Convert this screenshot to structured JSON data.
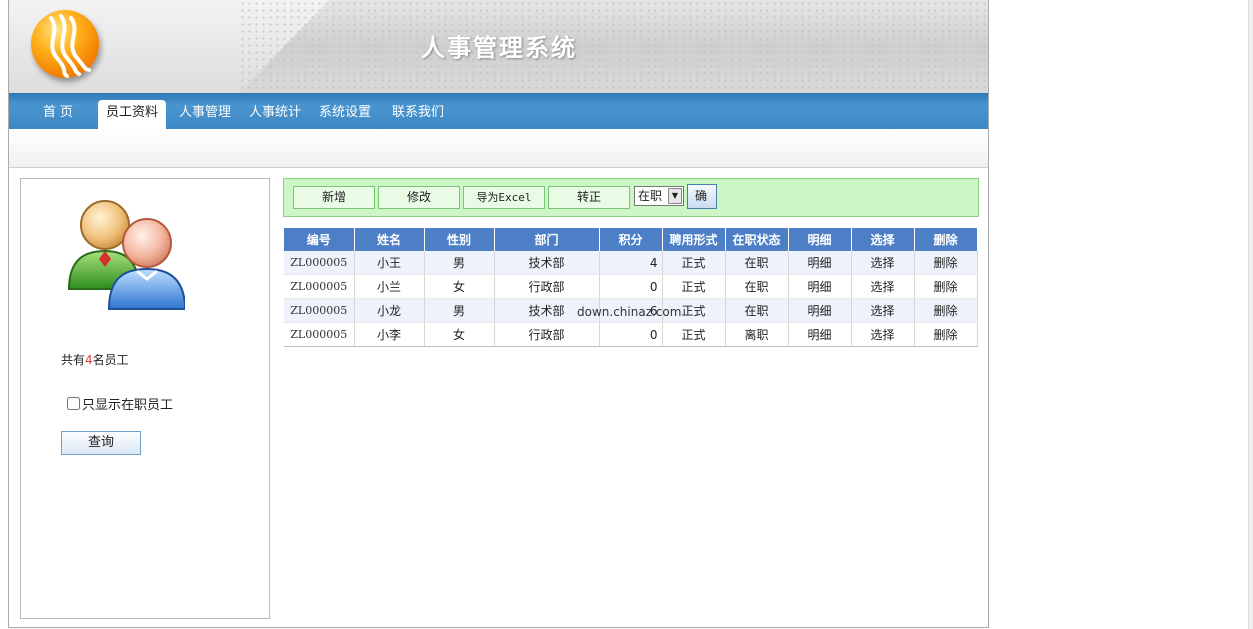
{
  "header": {
    "title": "人事管理系统",
    "logo_icon": "swirl-logo-icon"
  },
  "nav": {
    "items": [
      {
        "label": "首 页",
        "active": false
      },
      {
        "label": "员工资料",
        "active": true
      },
      {
        "label": "人事管理",
        "active": false
      },
      {
        "label": "人事统计",
        "active": false
      },
      {
        "label": "系统设置",
        "active": false
      },
      {
        "label": "联系我们",
        "active": false
      }
    ]
  },
  "sidebar": {
    "icon": "users-icon",
    "count_prefix": "共有",
    "count": "4",
    "count_suffix": "名员工",
    "active_only_label": "只显示在职员工",
    "active_only_checked": false,
    "query_label": "查询"
  },
  "toolbar": {
    "add_label": "新增",
    "edit_label": "修改",
    "export_label": "导为Excel",
    "regularize_label": "转正",
    "status_selected": "在职",
    "confirm_label": "确定"
  },
  "table": {
    "columns": [
      "编号",
      "姓名",
      "性别",
      "部门",
      "积分",
      "聘用形式",
      "在职状态",
      "明细",
      "选择",
      "删除"
    ],
    "rows": [
      [
        "ZL000005",
        "小王",
        "男",
        "技术部",
        "4",
        "正式",
        "在职",
        "明细",
        "选择",
        "删除"
      ],
      [
        "ZL000005",
        "小兰",
        "女",
        "行政部",
        "0",
        "正式",
        "在职",
        "明细",
        "选择",
        "删除"
      ],
      [
        "ZL000005",
        "小龙",
        "男",
        "技术部",
        "6",
        "正式",
        "在职",
        "明细",
        "选择",
        "删除"
      ],
      [
        "ZL000005",
        "小李",
        "女",
        "行政部",
        "0",
        "正式",
        "离职",
        "明细",
        "选择",
        "删除"
      ]
    ]
  },
  "watermark": "down.chinaz.com",
  "colors": {
    "nav_blue": "#3c86c4",
    "header_blue": "#4d7fc7",
    "toolbar_green": "#ccf6c6",
    "count_red": "#e23c3c"
  }
}
